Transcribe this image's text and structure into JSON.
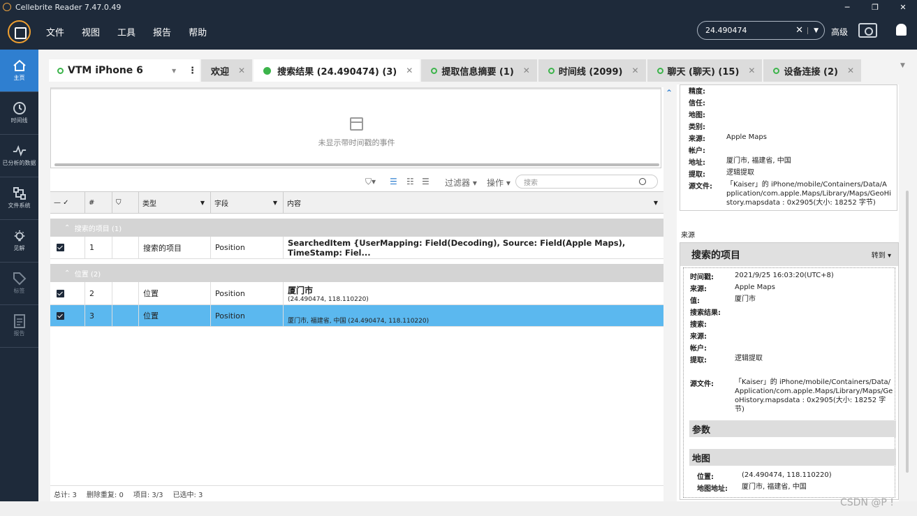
{
  "titlebar": {
    "title": "Cellebrite Reader 7.47.0.49",
    "minimize": "─",
    "maximize": "❐",
    "close": "✕"
  },
  "menu": {
    "items": [
      "文件",
      "视图",
      "工具",
      "报告",
      "帮助"
    ]
  },
  "search": {
    "value": "24.490474",
    "advanced": "高级"
  },
  "sidebar": {
    "items": [
      {
        "label": "主页",
        "icon": "home-icon"
      },
      {
        "label": "时间线",
        "icon": "clock-icon"
      },
      {
        "label": "已分析的数据",
        "icon": "pulse-icon"
      },
      {
        "label": "文件系统",
        "icon": "filesystem-icon"
      },
      {
        "label": "见解",
        "icon": "lightbulb-icon"
      },
      {
        "label": "标签",
        "icon": "tag-icon"
      },
      {
        "label": "报告",
        "icon": "report-icon"
      }
    ]
  },
  "device": {
    "name": "VTM iPhone 6"
  },
  "tabs": [
    {
      "label": "欢迎"
    },
    {
      "label": "搜索结果 (24.490474) (3)"
    },
    {
      "label": "提取信息摘要 (1)"
    },
    {
      "label": "时间线 (2099)"
    },
    {
      "label": "聊天 (聊天) (15)"
    },
    {
      "label": "设备连接 (2)"
    }
  ],
  "timeline": {
    "empty_message": "未显示带时间戳的事件"
  },
  "toolbar": {
    "filter": "过滤器",
    "actions": "操作",
    "search_placeholder": "搜索"
  },
  "grid": {
    "headers": {
      "num": "#",
      "type": "类型",
      "field": "字段",
      "content": "内容"
    },
    "groups": [
      {
        "label": "搜索的项目 (1)",
        "rows": [
          {
            "num": "1",
            "type": "搜索的项目",
            "field": "Position",
            "title": "SearchedItem {UserMapping: Field(Decoding), Source: Field(Apple Maps), TimeStamp: Fiel...",
            "sub": ""
          }
        ]
      },
      {
        "label": "位置 (2)",
        "rows": [
          {
            "num": "2",
            "type": "位置",
            "field": "Position",
            "title": "厦门市",
            "sub": "(24.490474, 118.110220)"
          },
          {
            "num": "3",
            "type": "位置",
            "field": "Position",
            "title": "",
            "sub": "厦门市, 福建省, 中国 (24.490474, 118.110220)"
          }
        ]
      }
    ]
  },
  "statusbar": {
    "total": "总计: 3",
    "dedup": "删除重复: 0",
    "items": "项目: 3/3",
    "selected": "已选中: 3"
  },
  "details_top": [
    {
      "k": "精度:",
      "v": ""
    },
    {
      "k": "信任:",
      "v": ""
    },
    {
      "k": "地图:",
      "v": ""
    },
    {
      "k": "类别:",
      "v": ""
    },
    {
      "k": "来源:",
      "v": "Apple Maps"
    },
    {
      "k": "帐户:",
      "v": ""
    },
    {
      "k": "地址:",
      "v": "厦门市, 福建省, 中国"
    },
    {
      "k": "提取:",
      "v": "逻辑提取"
    },
    {
      "k": "源文件:",
      "v": "「Kaiser」的 iPhone/mobile/Containers/Data/Application/com.apple.Maps/Library/Maps/GeoHistory.mapsdata : 0x2905(大小: 18252 字节)"
    }
  ],
  "source_label": "来源",
  "source_panel": {
    "title": "搜索的项目",
    "goto": "转到",
    "fields": [
      {
        "k": "时间戳:",
        "v": "2021/9/25 16:03:20(UTC+8)"
      },
      {
        "k": "来源:",
        "v": "Apple Maps"
      },
      {
        "k": "值:",
        "v": "厦门市"
      },
      {
        "k": "搜索结果:",
        "v": ""
      },
      {
        "k": "搜索:",
        "v": ""
      },
      {
        "k": "来源:",
        "v": ""
      },
      {
        "k": "帐户:",
        "v": ""
      },
      {
        "k": "提取:",
        "v": "逻辑提取"
      }
    ],
    "source_file": {
      "k": "源文件:",
      "v": "「Kaiser」的 iPhone/mobile/Containers/Data/Application/com.apple.Maps/Library/Maps/GeoHistory.mapsdata : 0x2905(大小: 18252 字节)"
    },
    "params_title": "参数",
    "map_title": "地图",
    "map_fields": [
      {
        "k": "位置:",
        "v": "(24.490474, 118.110220)"
      },
      {
        "k": "地图地址:",
        "v": "厦门市, 福建省, 中国"
      }
    ]
  },
  "watermark": "CSDN @P !",
  "colors": {
    "accent": "#2f7fd0",
    "selection": "#5bb8ef",
    "nav_bg": "#1e2a3a",
    "status_green": "#3cb44b"
  }
}
